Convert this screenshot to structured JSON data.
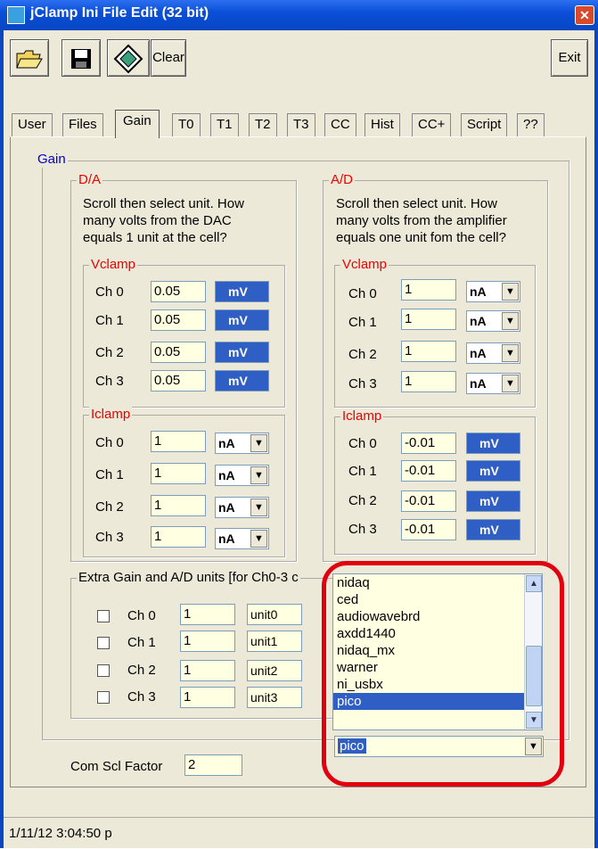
{
  "window": {
    "title": "jClamp Ini File Edit (32 bit)",
    "close": "✕"
  },
  "toolbar": {
    "open_icon": "folder-open-icon",
    "save_icon": "floppy-disk-icon",
    "app_icon": "diamond-icon",
    "clear_label": "Clear",
    "exit_label": "Exit"
  },
  "tabs": [
    "User",
    "Files",
    "Gain",
    "T0",
    "T1",
    "T2",
    "T3",
    "CC",
    "Hist",
    "CC+",
    "Script",
    "??"
  ],
  "active_tab": "Gain",
  "gain": {
    "legend": "Gain",
    "da": {
      "legend": "D/A",
      "description": [
        "Scroll then select unit. How",
        "many volts from the DAC",
        "equals 1 unit at the cell?"
      ],
      "vclamp": {
        "legend": "Vclamp",
        "rows": [
          {
            "label": "Ch 0",
            "value": "0.05",
            "unit": "mV"
          },
          {
            "label": "Ch 1",
            "value": "0.05",
            "unit": "mV"
          },
          {
            "label": "Ch 2",
            "value": "0.05",
            "unit": "mV"
          },
          {
            "label": "Ch 3",
            "value": "0.05",
            "unit": "mV"
          }
        ]
      },
      "iclamp": {
        "legend": "Iclamp",
        "rows": [
          {
            "label": "Ch 0",
            "value": "1",
            "unit": "nA"
          },
          {
            "label": "Ch 1",
            "value": "1",
            "unit": "nA"
          },
          {
            "label": "Ch 2",
            "value": "1",
            "unit": "nA"
          },
          {
            "label": "Ch 3",
            "value": "1",
            "unit": "nA"
          }
        ]
      }
    },
    "ad": {
      "legend": "A/D",
      "description": [
        "Scroll then select unit. How",
        "many volts from the amplifier",
        "equals one unit fom the cell?"
      ],
      "vclamp": {
        "legend": "Vclamp",
        "rows": [
          {
            "label": "Ch 0",
            "value": "1",
            "unit": "nA"
          },
          {
            "label": "Ch 1",
            "value": "1",
            "unit": "nA"
          },
          {
            "label": "Ch 2",
            "value": "1",
            "unit": "nA"
          },
          {
            "label": "Ch 3",
            "value": "1",
            "unit": "nA"
          }
        ]
      },
      "iclamp": {
        "legend": "Iclamp",
        "rows": [
          {
            "label": "Ch 0",
            "value": "-0.01",
            "unit": "mV"
          },
          {
            "label": "Ch 1",
            "value": "-0.01",
            "unit": "mV"
          },
          {
            "label": "Ch 2",
            "value": "-0.01",
            "unit": "mV"
          },
          {
            "label": "Ch 3",
            "value": "-0.01",
            "unit": "mV"
          }
        ]
      }
    },
    "extra": {
      "legend": "Extra Gain and A/D units [for Ch0-3 c",
      "rows": [
        {
          "label": "Ch 0",
          "value": "1",
          "unit": "unit0"
        },
        {
          "label": "Ch 1",
          "value": "1",
          "unit": "unit1"
        },
        {
          "label": "Ch 2",
          "value": "1",
          "unit": "unit2"
        },
        {
          "label": "Ch 3",
          "value": "1",
          "unit": "unit3"
        }
      ]
    },
    "com_scl": {
      "label": "Com Scl Factor",
      "value": "2"
    }
  },
  "hardware": {
    "options": [
      "nidaq",
      "ced",
      "audiowavebrd",
      "axdd1440",
      "nidaq_mx",
      "warner",
      "ni_usbx",
      "pico"
    ],
    "selected": "pico",
    "highlight_color": "#e00010"
  },
  "status": {
    "text": "1/11/12 3:04:50 p"
  },
  "colors": {
    "titlebar": "#0a4fd8",
    "selected": "#2f5fc4",
    "legend_red": "#ee0000",
    "legend_blue": "#0000cc",
    "input_bg": "#ffffe1"
  }
}
